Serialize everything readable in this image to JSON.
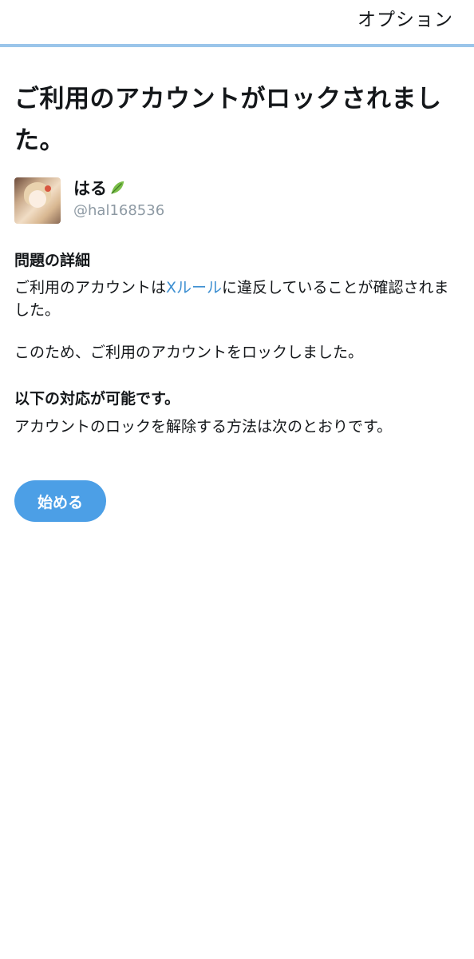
{
  "header": {
    "options_label": "オプション"
  },
  "page": {
    "title": "ご利用のアカウントがロックされました。"
  },
  "account": {
    "display_name": "はる",
    "handle": "@hal168536",
    "name_emoji": "leaf-icon"
  },
  "details": {
    "heading": "問題の詳細",
    "violation_prefix": "ご利用のアカウントは",
    "rules_link": "Xルール",
    "violation_suffix": "に違反していることが確認されました。",
    "lock_notice": "このため、ご利用のアカウントをロックしました。"
  },
  "actions": {
    "heading": "以下の対応が可能です。",
    "description": "アカウントのロックを解除する方法は次のとおりです。",
    "start_label": "始める"
  },
  "colors": {
    "accent": "#4c9fe6",
    "link": "#3d8fd1",
    "divider": "#9ac5ea",
    "muted": "#8e9aa4"
  }
}
